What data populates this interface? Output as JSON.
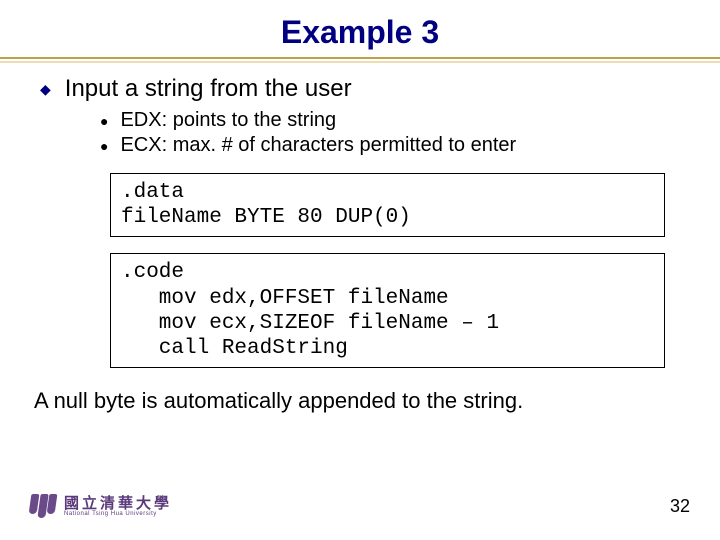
{
  "title": "Example 3",
  "bullets": {
    "main": "Input a string from the user",
    "subs": [
      "EDX: points to the string",
      "ECX: max. # of characters permitted to enter"
    ]
  },
  "code1": ".data\nfileName BYTE 80 DUP(0)",
  "code2": ".code\n   mov edx,OFFSET fileName\n   mov ecx,SIZEOF fileName – 1\n   call ReadString",
  "tail": "A null byte is automatically appended to the string.",
  "footer": {
    "uni_cn": "國立清華大學",
    "uni_en": "National Tsing Hua University",
    "page": "32"
  }
}
